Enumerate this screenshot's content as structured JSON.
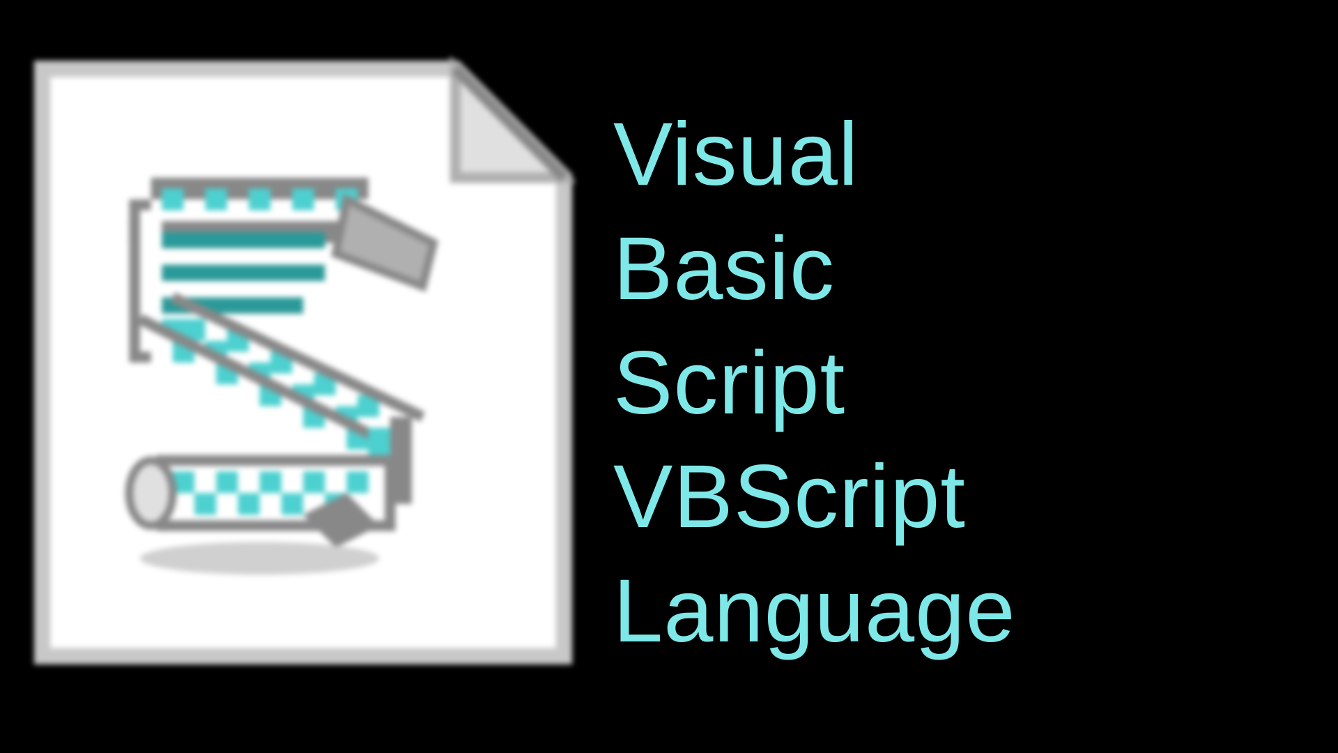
{
  "text": {
    "line1": "Visual",
    "line2": "Basic",
    "line3": "Script",
    "line4": "VBScript",
    "line5": "Language"
  },
  "colors": {
    "background": "#000000",
    "text": "#7EE8E8",
    "icon_accent": "#4DD0D0",
    "icon_paper": "#FFFFFF",
    "icon_border": "#C8C8C8",
    "icon_dark": "#888888"
  },
  "icon": {
    "name": "vbscript-file-icon",
    "description": "script-file-document"
  }
}
